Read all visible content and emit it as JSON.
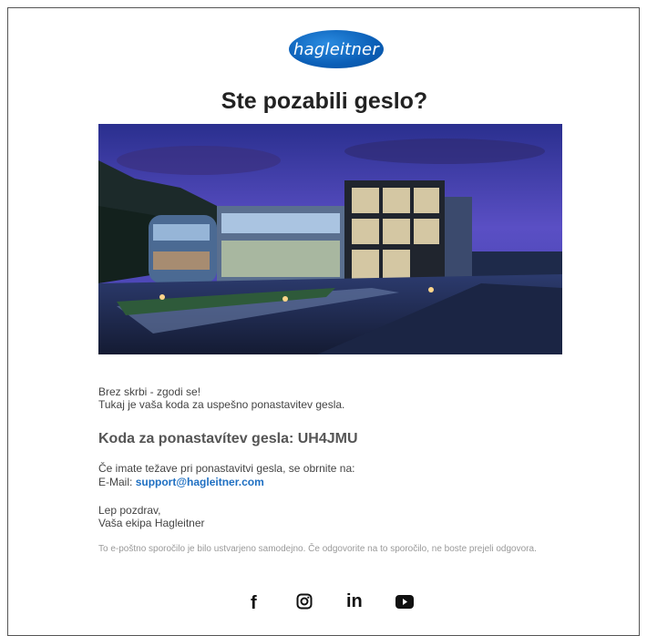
{
  "header": {
    "logo_text": "hagleitner",
    "title": "Ste pozabili geslo?"
  },
  "hero": {
    "icon": "building-photo"
  },
  "body": {
    "line1": "Brez skrbi - zgodi se!",
    "line2": "Tukaj je vaša koda za uspešno ponastavitev gesla.",
    "code_label": "Koda za ponastavítev gesla: UH4JMU",
    "help_line": "Če imate težave pri ponastavitvi gesla, se obrnite na:",
    "email_label": "E-Mail:",
    "email": "support@hagleitner.com",
    "greeting": "Lep pozdrav,",
    "signature": "Vaša ekipa Hagleitner",
    "disclaimer": "To e-poštno sporočilo je bilo ustvarjeno samodejno. Če odgovorite na to sporočilo, ne boste prejeli odgovora."
  },
  "social": {
    "facebook": "f",
    "icons": [
      "facebook-icon",
      "instagram-icon",
      "linkedin-icon",
      "youtube-icon"
    ],
    "linkedin": "in"
  },
  "colors": {
    "brand_blue": "#0b5fb7",
    "link": "#1e6fc2",
    "disclaimer": "#999999"
  }
}
